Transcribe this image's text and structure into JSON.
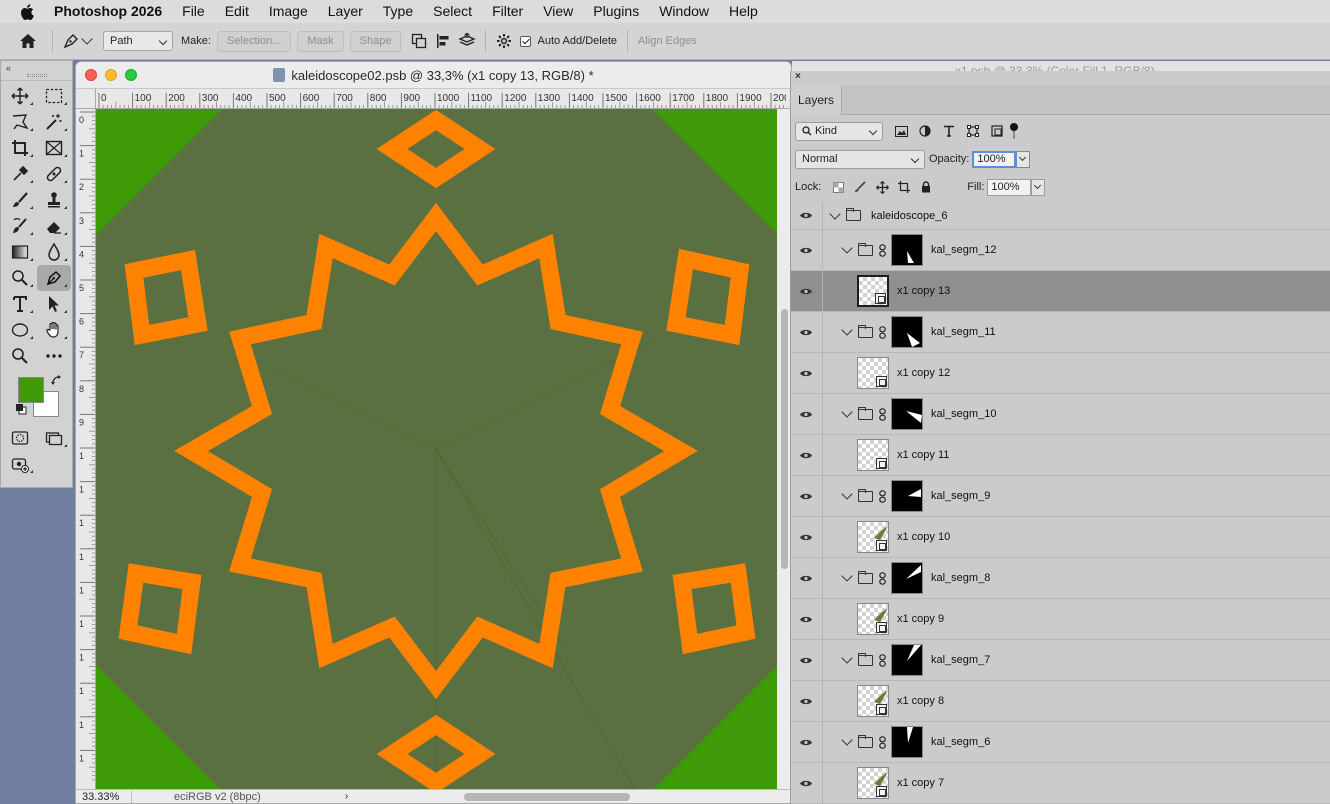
{
  "menubar": {
    "app_name": "Photoshop 2026",
    "items": [
      "File",
      "Edit",
      "Image",
      "Layer",
      "Type",
      "Select",
      "Filter",
      "View",
      "Plugins",
      "Window",
      "Help"
    ]
  },
  "options": {
    "mode_value": "Path",
    "make_label": "Make:",
    "selection_label": "Selection...",
    "mask_label": "Mask",
    "shape_label": "Shape",
    "auto_add_delete_label": "Auto Add/Delete",
    "align_edges_label": "Align Edges"
  },
  "document": {
    "title": "kaleidoscope02.psb @ 33,3% (x1 copy 13, RGB/8) *",
    "zoom": "33.33%",
    "profile": "eciRGB v2 (8bpc)",
    "ruler_h": [
      "0",
      "100",
      "200",
      "300",
      "400",
      "500",
      "600",
      "700",
      "800",
      "900",
      "1000",
      "1100",
      "1200",
      "1300",
      "1400",
      "1500",
      "1600",
      "1700",
      "1800",
      "1900",
      "200"
    ],
    "ruler_v": [
      "0",
      "1",
      "2",
      "3",
      "4",
      "5",
      "6",
      "7",
      "8",
      "9",
      "1",
      "1",
      "1",
      "1",
      "1",
      "1",
      "1",
      "1",
      "1",
      "1"
    ]
  },
  "background_window": {
    "title": "x1.psb @ 33,3% (Color Fill 1, RGB/8)"
  },
  "layers_panel": {
    "tab": "Layers",
    "kind_filter": "Kind",
    "blend_mode": "Normal",
    "opacity_label": "Opacity:",
    "opacity_value": "100%",
    "lock_label": "Lock:",
    "fill_label": "Fill:",
    "fill_value": "100%",
    "root_group": "kaleidoscope_6",
    "layers": [
      {
        "name": "kal_segm_12",
        "type": "group"
      },
      {
        "name": "x1 copy 13",
        "type": "smart",
        "selected": true
      },
      {
        "name": "kal_segm_11",
        "type": "group"
      },
      {
        "name": "x1 copy 12",
        "type": "smart"
      },
      {
        "name": "kal_segm_10",
        "type": "group"
      },
      {
        "name": "x1 copy 11",
        "type": "smart"
      },
      {
        "name": "kal_segm_9",
        "type": "group"
      },
      {
        "name": "x1 copy 10",
        "type": "smart"
      },
      {
        "name": "kal_segm_8",
        "type": "group"
      },
      {
        "name": "x1 copy 9",
        "type": "smart"
      },
      {
        "name": "kal_segm_7",
        "type": "group"
      },
      {
        "name": "x1 copy 8",
        "type": "smart"
      },
      {
        "name": "kal_segm_6",
        "type": "group"
      },
      {
        "name": "x1 copy 7",
        "type": "smart"
      }
    ]
  },
  "colors": {
    "foreground": "#3f9a0a",
    "background": "#ffffff",
    "canvas_olive": "#5a7040",
    "orange": "#ff8200"
  }
}
